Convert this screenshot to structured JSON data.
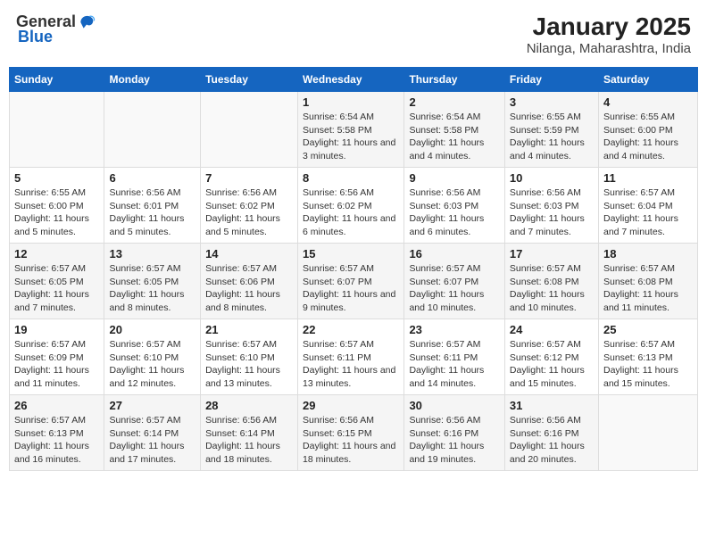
{
  "header": {
    "logo_general": "General",
    "logo_blue": "Blue",
    "title": "January 2025",
    "subtitle": "Nilanga, Maharashtra, India"
  },
  "days_of_week": [
    "Sunday",
    "Monday",
    "Tuesday",
    "Wednesday",
    "Thursday",
    "Friday",
    "Saturday"
  ],
  "weeks": [
    [
      {
        "day": "",
        "info": ""
      },
      {
        "day": "",
        "info": ""
      },
      {
        "day": "",
        "info": ""
      },
      {
        "day": "1",
        "info": "Sunrise: 6:54 AM\nSunset: 5:58 PM\nDaylight: 11 hours and 3 minutes."
      },
      {
        "day": "2",
        "info": "Sunrise: 6:54 AM\nSunset: 5:58 PM\nDaylight: 11 hours and 4 minutes."
      },
      {
        "day": "3",
        "info": "Sunrise: 6:55 AM\nSunset: 5:59 PM\nDaylight: 11 hours and 4 minutes."
      },
      {
        "day": "4",
        "info": "Sunrise: 6:55 AM\nSunset: 6:00 PM\nDaylight: 11 hours and 4 minutes."
      }
    ],
    [
      {
        "day": "5",
        "info": "Sunrise: 6:55 AM\nSunset: 6:00 PM\nDaylight: 11 hours and 5 minutes."
      },
      {
        "day": "6",
        "info": "Sunrise: 6:56 AM\nSunset: 6:01 PM\nDaylight: 11 hours and 5 minutes."
      },
      {
        "day": "7",
        "info": "Sunrise: 6:56 AM\nSunset: 6:02 PM\nDaylight: 11 hours and 5 minutes."
      },
      {
        "day": "8",
        "info": "Sunrise: 6:56 AM\nSunset: 6:02 PM\nDaylight: 11 hours and 6 minutes."
      },
      {
        "day": "9",
        "info": "Sunrise: 6:56 AM\nSunset: 6:03 PM\nDaylight: 11 hours and 6 minutes."
      },
      {
        "day": "10",
        "info": "Sunrise: 6:56 AM\nSunset: 6:03 PM\nDaylight: 11 hours and 7 minutes."
      },
      {
        "day": "11",
        "info": "Sunrise: 6:57 AM\nSunset: 6:04 PM\nDaylight: 11 hours and 7 minutes."
      }
    ],
    [
      {
        "day": "12",
        "info": "Sunrise: 6:57 AM\nSunset: 6:05 PM\nDaylight: 11 hours and 7 minutes."
      },
      {
        "day": "13",
        "info": "Sunrise: 6:57 AM\nSunset: 6:05 PM\nDaylight: 11 hours and 8 minutes."
      },
      {
        "day": "14",
        "info": "Sunrise: 6:57 AM\nSunset: 6:06 PM\nDaylight: 11 hours and 8 minutes."
      },
      {
        "day": "15",
        "info": "Sunrise: 6:57 AM\nSunset: 6:07 PM\nDaylight: 11 hours and 9 minutes."
      },
      {
        "day": "16",
        "info": "Sunrise: 6:57 AM\nSunset: 6:07 PM\nDaylight: 11 hours and 10 minutes."
      },
      {
        "day": "17",
        "info": "Sunrise: 6:57 AM\nSunset: 6:08 PM\nDaylight: 11 hours and 10 minutes."
      },
      {
        "day": "18",
        "info": "Sunrise: 6:57 AM\nSunset: 6:08 PM\nDaylight: 11 hours and 11 minutes."
      }
    ],
    [
      {
        "day": "19",
        "info": "Sunrise: 6:57 AM\nSunset: 6:09 PM\nDaylight: 11 hours and 11 minutes."
      },
      {
        "day": "20",
        "info": "Sunrise: 6:57 AM\nSunset: 6:10 PM\nDaylight: 11 hours and 12 minutes."
      },
      {
        "day": "21",
        "info": "Sunrise: 6:57 AM\nSunset: 6:10 PM\nDaylight: 11 hours and 13 minutes."
      },
      {
        "day": "22",
        "info": "Sunrise: 6:57 AM\nSunset: 6:11 PM\nDaylight: 11 hours and 13 minutes."
      },
      {
        "day": "23",
        "info": "Sunrise: 6:57 AM\nSunset: 6:11 PM\nDaylight: 11 hours and 14 minutes."
      },
      {
        "day": "24",
        "info": "Sunrise: 6:57 AM\nSunset: 6:12 PM\nDaylight: 11 hours and 15 minutes."
      },
      {
        "day": "25",
        "info": "Sunrise: 6:57 AM\nSunset: 6:13 PM\nDaylight: 11 hours and 15 minutes."
      }
    ],
    [
      {
        "day": "26",
        "info": "Sunrise: 6:57 AM\nSunset: 6:13 PM\nDaylight: 11 hours and 16 minutes."
      },
      {
        "day": "27",
        "info": "Sunrise: 6:57 AM\nSunset: 6:14 PM\nDaylight: 11 hours and 17 minutes."
      },
      {
        "day": "28",
        "info": "Sunrise: 6:56 AM\nSunset: 6:14 PM\nDaylight: 11 hours and 18 minutes."
      },
      {
        "day": "29",
        "info": "Sunrise: 6:56 AM\nSunset: 6:15 PM\nDaylight: 11 hours and 18 minutes."
      },
      {
        "day": "30",
        "info": "Sunrise: 6:56 AM\nSunset: 6:16 PM\nDaylight: 11 hours and 19 minutes."
      },
      {
        "day": "31",
        "info": "Sunrise: 6:56 AM\nSunset: 6:16 PM\nDaylight: 11 hours and 20 minutes."
      },
      {
        "day": "",
        "info": ""
      }
    ]
  ]
}
